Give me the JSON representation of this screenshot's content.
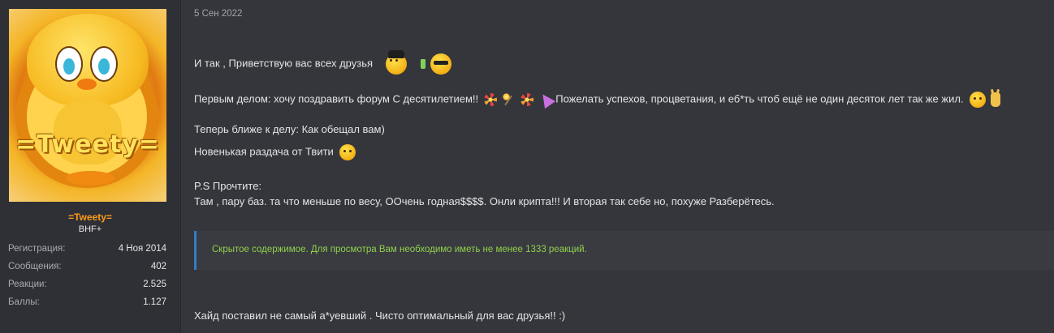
{
  "user": {
    "avatar_nick": "=Tweety=",
    "name": "=Tweety=",
    "title": "BHF+",
    "stats": [
      {
        "label": "Регистрация:",
        "value": "4 Ноя 2014"
      },
      {
        "label": "Сообщения:",
        "value": "402"
      },
      {
        "label": "Реакции:",
        "value": "2.525"
      },
      {
        "label": "Баллы:",
        "value": "1.127"
      }
    ]
  },
  "post": {
    "date": "5 Сен 2022",
    "line1": "И так , Приветствую вас всех друзья",
    "line2": "Первым делом: хочу поздравить форум С десятилетием!!",
    "line2b": "Пожелать успехов, процветания, и еб*ть чтоб ещё не один десяток лет так же жил.",
    "line3": "Теперь ближе к делу: Как обещал вам)",
    "line4": "Новенькая раздача от Твити",
    "line5": "P.S Прочтите:",
    "line6": "Там , пару баз. та что меньше по весу, ООчень годная$$$$. Онли крипта!!! И вторая так себе но, похуже Разберётесь.",
    "hidden_notice": "Скрытое содержимое. Для просмотра Вам необходимо иметь не менее 1333 реакций.",
    "line7": "Хайд поставил не самый а*уевший . Чисто оптимальный для вас друзья!! :)"
  },
  "colors": {
    "background": "#35363c",
    "username": "#ff9d1c",
    "hidden_text": "#8fd14b",
    "hidden_border": "#2f7fc8"
  },
  "icons": [
    "smiley-hat-icon",
    "drink-icon",
    "smiley-sunglasses-icon",
    "firework-icon",
    "sparkler-icon",
    "party-popper-icon",
    "hugging-face-icon",
    "victory-hand-icon",
    "sweating-smiley-icon"
  ]
}
